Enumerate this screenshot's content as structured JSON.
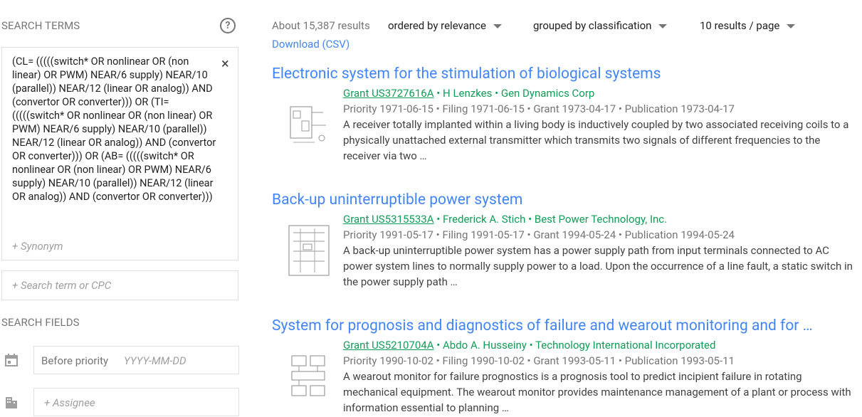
{
  "left": {
    "search_terms_label": "SEARCH TERMS",
    "help_icon": "?",
    "query_text": "(CL= (((((switch* OR nonlinear OR (non linear) OR PWM) NEAR/6 supply) NEAR/10 (parallel)) NEAR/12 (linear OR analog)) AND (convertor OR converter))) OR (TI= (((((switch* OR nonlinear OR (non linear) OR PWM) NEAR/6 supply) NEAR/10 (parallel)) NEAR/12 (linear OR analog)) AND (convertor OR converter))) OR (AB= (((((switch* OR nonlinear OR (non linear) OR PWM) NEAR/6 supply) NEAR/10 (parallel)) NEAR/12 (linear OR analog)) AND (convertor OR converter)))",
    "close_icon": "×",
    "synonym_placeholder": "+ Synonym",
    "search_term_placeholder": "+ Search term or CPC",
    "search_fields_label": "SEARCH FIELDS",
    "before_label": "Before priority",
    "date_placeholder": "YYYY-MM-DD",
    "assignee_placeholder": "+ Assignee"
  },
  "top": {
    "count": "About 15,387 results",
    "order": "ordered by relevance",
    "group": "grouped by classification",
    "per_page": "10 results / page",
    "download": "Download (CSV)"
  },
  "results": [
    {
      "title": "Electronic system for the stimulation of biological systems",
      "id": "Grant US3727616A",
      "people": " • H Lenzkes • Gen Dynamics Corp",
      "dates": "Priority 1971-06-15 • Filing 1971-06-15 • Grant 1973-04-17 • Publication 1973-04-17",
      "abstract": "A receiver totally implanted within a living body is inductively coupled by two associated receiving coils to a physically unattached external transmitter which transmits two signals of different frequencies to the receiver via two …"
    },
    {
      "title": "Back-up uninterruptible power system",
      "id": "Grant US5315533A",
      "people": " • Frederick A. Stich • Best Power Technology, Inc.",
      "dates": "Priority 1991-05-17 • Filing 1991-05-17 • Grant 1994-05-24 • Publication 1994-05-24",
      "abstract": "A back-up uninterruptible power system has a power supply path from input terminals connected to AC power system lines to normally supply power to a load. Upon the occurrence of a line fault, a static switch in the power supply path …"
    },
    {
      "title": "System for prognosis and diagnostics of failure and wearout monitoring and for …",
      "id": "Grant US5210704A",
      "people": " • Abdo A. Husseiny • Technology International Incorporated",
      "dates": "Priority 1990-10-02 • Filing 1990-10-02 • Grant 1993-05-11 • Publication 1993-05-11",
      "abstract": "A wearout monitor for failure prognostics is a prognosis tool to predict incipient failure in rotating mechanical equipment. The wearout monitor provides maintenance management of a plant or process with information essential to planning …"
    }
  ]
}
